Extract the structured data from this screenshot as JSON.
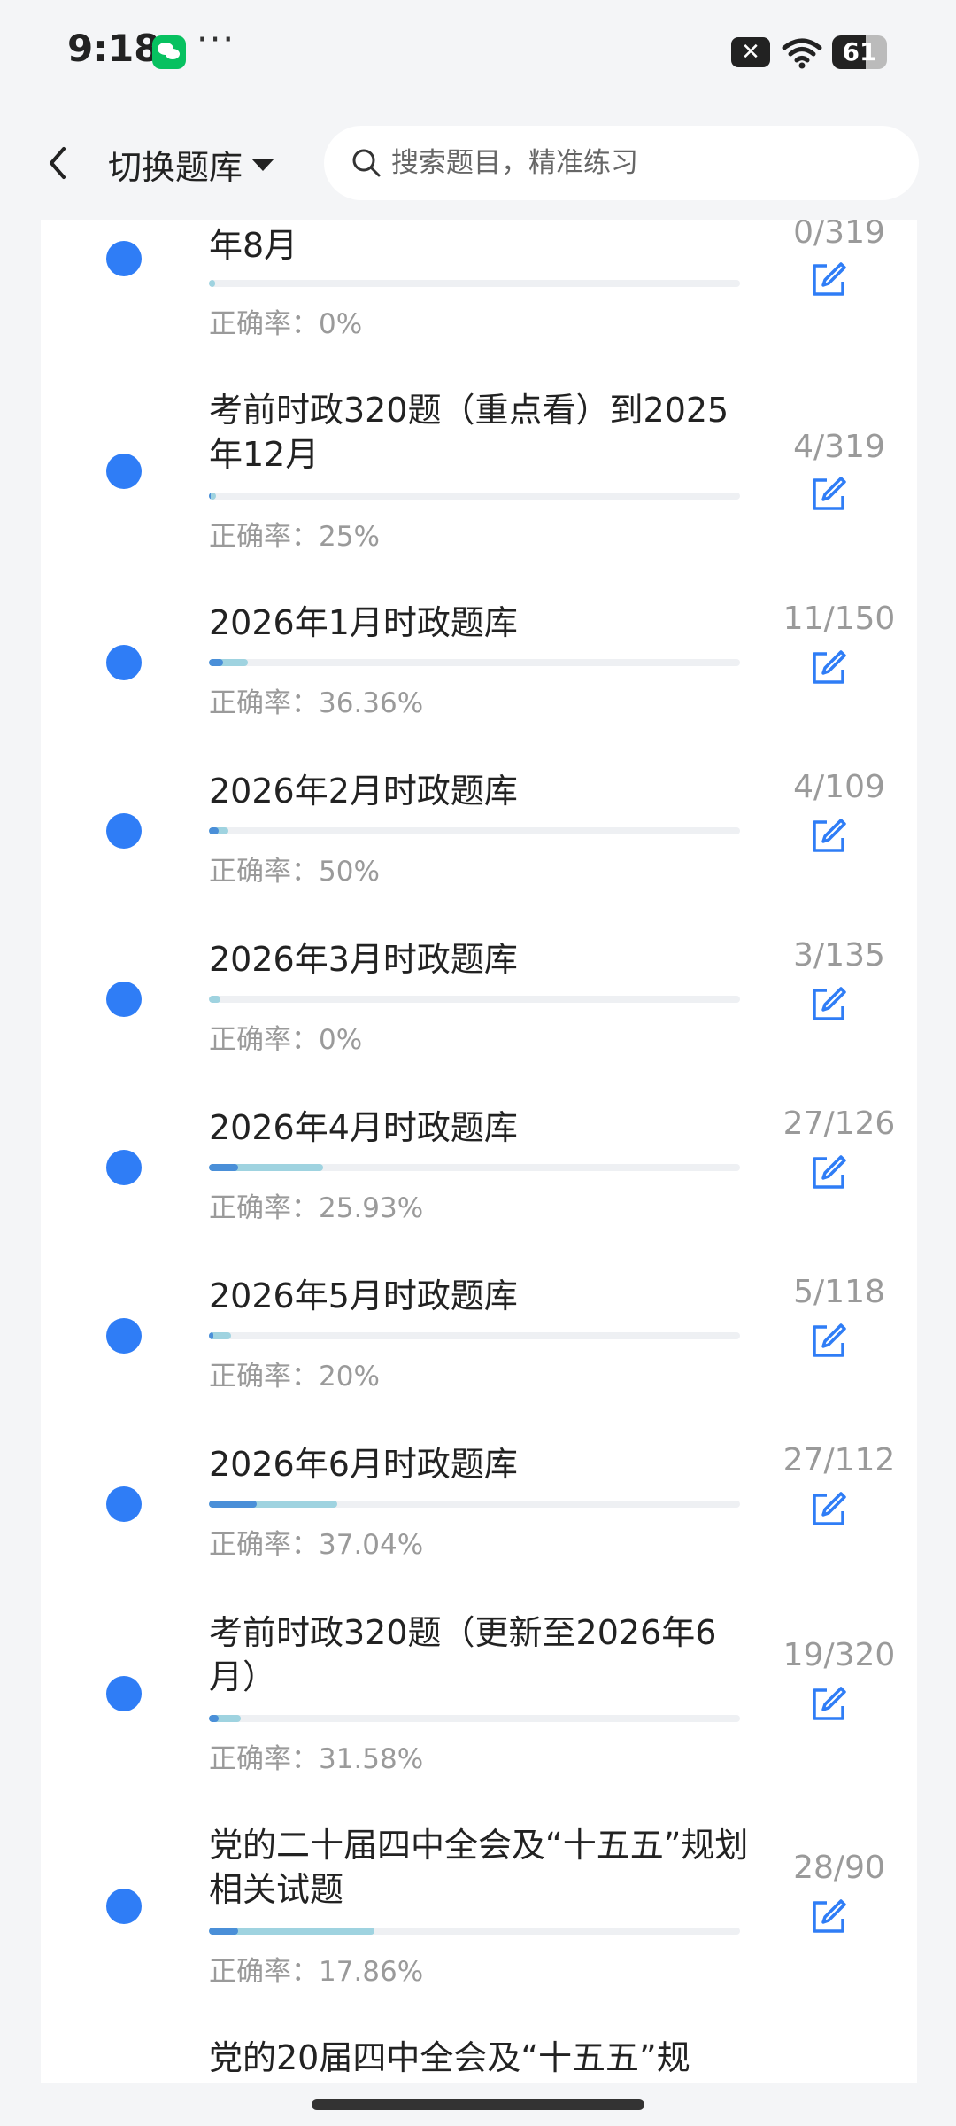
{
  "status_bar": {
    "time": "9:18",
    "wechat_icon": "wechat-icon",
    "more": "···",
    "battery": "61",
    "battery_level": 0.61
  },
  "header": {
    "switch_label": "切换题库",
    "search_placeholder": "搜索题目，精准练习"
  },
  "colors": {
    "accent": "#2f7df6",
    "progress_done": "#9fd3e0",
    "progress_correct": "#4a8fd8",
    "muted": "#9a9a9a"
  },
  "items": [
    {
      "title": "年8月",
      "accuracy": "正确率：0%",
      "count": "0/319",
      "done": 0,
      "total": 319,
      "correct_ratio": 0
    },
    {
      "title": "考前时政320题（重点看）到2025年12月",
      "accuracy": "正确率：25%",
      "count": "4/319",
      "done": 4,
      "total": 319,
      "correct_ratio": 0.25
    },
    {
      "title": "2026年1月时政题库",
      "accuracy": "正确率：36.36%",
      "count": "11/150",
      "done": 11,
      "total": 150,
      "correct_ratio": 0.3636
    },
    {
      "title": "2026年2月时政题库",
      "accuracy": "正确率：50%",
      "count": "4/109",
      "done": 4,
      "total": 109,
      "correct_ratio": 0.5
    },
    {
      "title": "2026年3月时政题库",
      "accuracy": "正确率：0%",
      "count": "3/135",
      "done": 3,
      "total": 135,
      "correct_ratio": 0
    },
    {
      "title": "2026年4月时政题库",
      "accuracy": "正确率：25.93%",
      "count": "27/126",
      "done": 27,
      "total": 126,
      "correct_ratio": 0.2593
    },
    {
      "title": "2026年5月时政题库",
      "accuracy": "正确率：20%",
      "count": "5/118",
      "done": 5,
      "total": 118,
      "correct_ratio": 0.2
    },
    {
      "title": "2026年6月时政题库",
      "accuracy": "正确率：37.04%",
      "count": "27/112",
      "done": 27,
      "total": 112,
      "correct_ratio": 0.3704
    },
    {
      "title": "考前时政320题（更新至2026年6月）",
      "accuracy": "正确率：31.58%",
      "count": "19/320",
      "done": 19,
      "total": 320,
      "correct_ratio": 0.3158
    },
    {
      "title": "党的二十届四中全会及“十五五”规划相关试题",
      "accuracy": "正确率：17.86%",
      "count": "28/90",
      "done": 28,
      "total": 90,
      "correct_ratio": 0.1786
    },
    {
      "title": "党的20届四中全会及“十五五”规",
      "accuracy": "",
      "count": "",
      "done": 0,
      "total": 0,
      "correct_ratio": 0
    }
  ]
}
